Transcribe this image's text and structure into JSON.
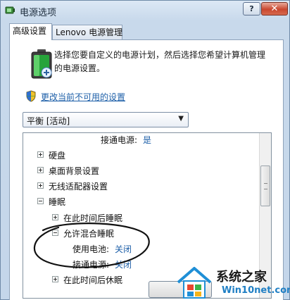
{
  "window": {
    "title": "电源选项",
    "help_label": "?",
    "close_label": "✕"
  },
  "tabs": [
    {
      "label": "高级设置",
      "active": true
    },
    {
      "label": "Lenovo 电源管理",
      "active": false
    }
  ],
  "intro": {
    "text": "选择您要自定义的电源计划，然后选择您希望计算机管理的电源设置。"
  },
  "change_link": "更改当前不可用的设置",
  "plan_select": {
    "value": "平衡 [活动]"
  },
  "tree": {
    "rows": [
      {
        "label": "接通电源:",
        "value": "是"
      },
      {
        "label": "硬盘",
        "expanded": false
      },
      {
        "label": "桌面背景设置",
        "expanded": false
      },
      {
        "label": "无线适配器设置",
        "expanded": false
      },
      {
        "label": "睡眠",
        "expanded": true
      },
      {
        "label": "在此时间后睡眠",
        "expanded": false
      },
      {
        "label": "允许混合睡眠",
        "expanded": true
      },
      {
        "label": "使用电池:",
        "value": "关闭"
      },
      {
        "label": "接通电源:",
        "value": "关闭"
      },
      {
        "label": "在此时间后休眠",
        "expanded": false
      }
    ]
  },
  "watermark": {
    "title": "系统之家",
    "url": "Win10net.com"
  },
  "colors": {
    "link": "#1d5fa8",
    "close_button": "#c9472f",
    "title_bar": "#dce8f5"
  },
  "icons": [
    "power-options-icon",
    "battery-power-icon",
    "uac-shield-icon",
    "chevron-down-icon"
  ]
}
